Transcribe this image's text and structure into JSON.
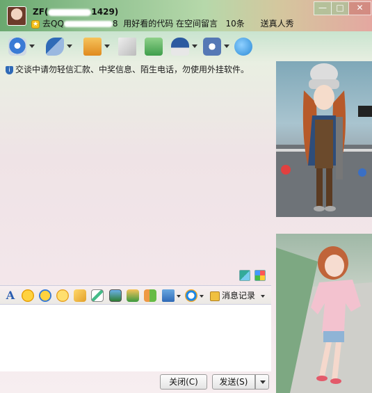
{
  "window": {
    "contact_name": "ZF",
    "contact_id_tail": "1429)",
    "signature_prefix": "去QQ",
    "signature_mid": "8",
    "signature_text": "用好看的代码 在空间留言",
    "signature_count": "10条",
    "show_link": "送真人秀",
    "controls": {
      "minimize": "—",
      "maximize": "□",
      "close": "✕"
    }
  },
  "toolbar": {
    "items": [
      {
        "name": "video-call",
        "icon": "webcam-icon",
        "color": "#3a7bd5"
      },
      {
        "name": "voice-call",
        "icon": "microphone-icon",
        "color": "#2f6ab7"
      },
      {
        "name": "send-file",
        "icon": "folder-icon",
        "color": "#e8a23a"
      },
      {
        "name": "send-sms",
        "icon": "envelope-icon",
        "color": "#c9c9c9"
      },
      {
        "name": "create-group",
        "icon": "add-chat-icon",
        "color": "#3e9e4b"
      },
      {
        "name": "remote-assist",
        "icon": "police-hat-icon",
        "color": "#2c5aa0"
      },
      {
        "name": "apps",
        "icon": "app-box-icon",
        "color": "#5578b5"
      },
      {
        "name": "share",
        "icon": "share-icon",
        "color": "#2a8ad6"
      }
    ]
  },
  "chat": {
    "security_notice": "交谈中请勿轻信汇款、中奖信息、陌生电话，勿使用外挂软件。"
  },
  "format_bar": {
    "font_label": "A",
    "history_label": "消息记录"
  },
  "input": {
    "value": ""
  },
  "buttons": {
    "close_label": "关闭(C)",
    "send_label": "发送(S)"
  }
}
